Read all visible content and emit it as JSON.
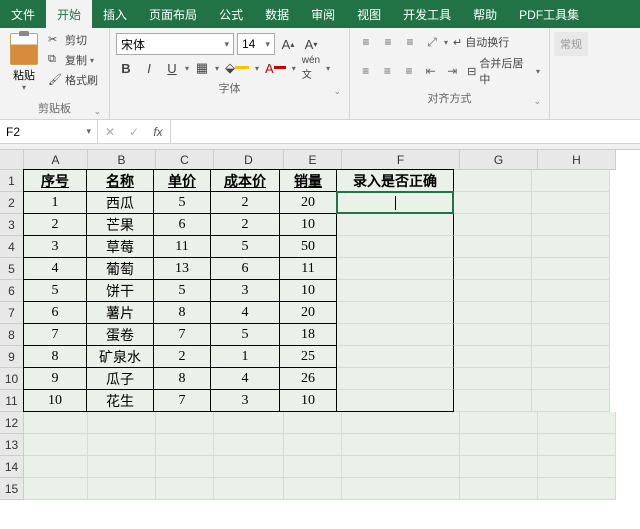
{
  "menu": {
    "file": "文件",
    "home": "开始",
    "insert": "插入",
    "layout": "页面布局",
    "formula": "公式",
    "data": "数据",
    "review": "审阅",
    "view": "视图",
    "dev": "开发工具",
    "help": "帮助",
    "pdf": "PDF工具集"
  },
  "ribbon": {
    "clipboard": {
      "paste": "粘贴",
      "cut": "剪切",
      "copy": "复制",
      "format": "格式刷",
      "label": "剪贴板"
    },
    "font": {
      "name": "宋体",
      "size": "14",
      "label": "字体"
    },
    "align": {
      "wrap": "自动换行",
      "merge": "合并后居中",
      "label": "对齐方式"
    },
    "style": {
      "normal": "常规"
    }
  },
  "bar": {
    "cell": "F2",
    "fx": "fx"
  },
  "cols": [
    "A",
    "B",
    "C",
    "D",
    "E",
    "F",
    "G",
    "H"
  ],
  "rowNums": [
    "1",
    "2",
    "3",
    "4",
    "5",
    "6",
    "7",
    "8",
    "9",
    "10",
    "11",
    "12",
    "13",
    "14",
    "15"
  ],
  "headers": {
    "a": "序号",
    "b": "名称",
    "c": "单价",
    "d": "成本价",
    "e": "销量",
    "f": "录入是否正确"
  },
  "data": [
    {
      "a": "1",
      "b": "西瓜",
      "c": "5",
      "d": "2",
      "e": "20"
    },
    {
      "a": "2",
      "b": "芒果",
      "c": "6",
      "d": "2",
      "e": "10"
    },
    {
      "a": "3",
      "b": "草莓",
      "c": "11",
      "d": "5",
      "e": "50"
    },
    {
      "a": "4",
      "b": "葡萄",
      "c": "13",
      "d": "6",
      "e": "11"
    },
    {
      "a": "5",
      "b": "饼干",
      "c": "5",
      "d": "3",
      "e": "10"
    },
    {
      "a": "6",
      "b": "薯片",
      "c": "8",
      "d": "4",
      "e": "20"
    },
    {
      "a": "7",
      "b": "蛋卷",
      "c": "7",
      "d": "5",
      "e": "18"
    },
    {
      "a": "8",
      "b": "矿泉水",
      "c": "2",
      "d": "1",
      "e": "25"
    },
    {
      "a": "9",
      "b": "瓜子",
      "c": "8",
      "d": "4",
      "e": "26"
    },
    {
      "a": "10",
      "b": "花生",
      "c": "7",
      "d": "3",
      "e": "10"
    }
  ]
}
